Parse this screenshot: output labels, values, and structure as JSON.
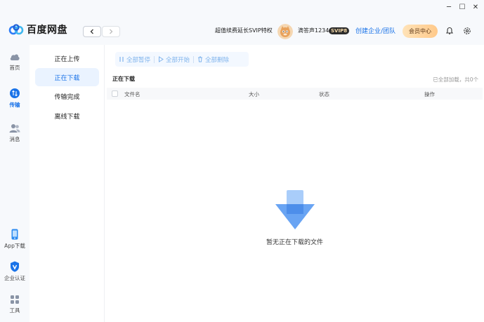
{
  "window": {
    "minimize_label": "─",
    "maximize_label": "☐",
    "close_label": "✕"
  },
  "header": {
    "app_name": "百度网盘",
    "promo": "超值续费延长SVIP特权",
    "username": "滴答声1234",
    "vip_badge": "SVIP8",
    "create_team": "创建企业/团队",
    "member_center": "会员中心"
  },
  "leftnav": {
    "items": [
      {
        "label": "首页",
        "icon": "cloud-icon"
      },
      {
        "label": "传输",
        "icon": "transfer-icon"
      },
      {
        "label": "消息",
        "icon": "contacts-icon"
      },
      {
        "label": "App下载",
        "icon": "phone-icon"
      },
      {
        "label": "企业认证",
        "icon": "verify-shield-icon"
      },
      {
        "label": "工具",
        "icon": "grid-tools-icon"
      }
    ],
    "active": "传输"
  },
  "subnav": {
    "items": [
      "正在上传",
      "正在下载",
      "传输完成",
      "离线下载"
    ],
    "active": "正在下载"
  },
  "toolbar": {
    "pause_all": "全部暂停",
    "start_all": "全部开始",
    "delete_all": "全部删除"
  },
  "main": {
    "title": "正在下载",
    "loaded_note": "已全部加载，共0个",
    "columns": {
      "name": "文件名",
      "size": "大小",
      "status": "状态",
      "action": "操作"
    },
    "empty_text": "暂无正在下载的文件"
  },
  "colors": {
    "accent": "#1a73e8",
    "sidebar_bg": "#f7f9fc",
    "active_bg": "#eaf3ff"
  }
}
